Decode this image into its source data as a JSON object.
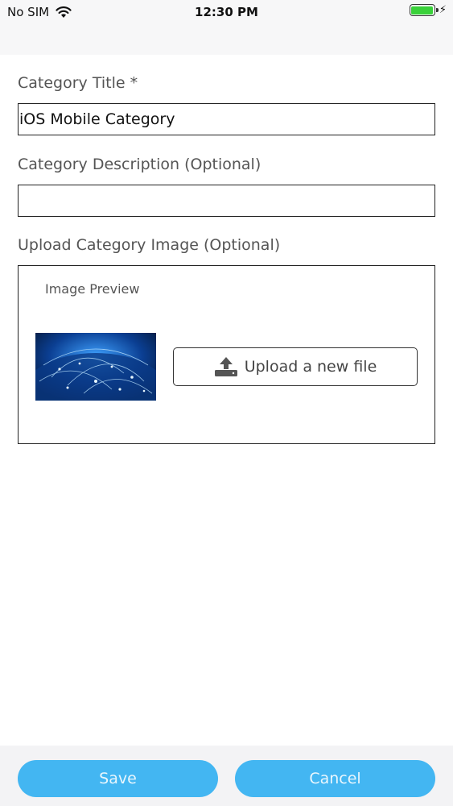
{
  "status_bar": {
    "carrier": "No SIM",
    "time": "12:30 PM",
    "battery_level": 1.0
  },
  "form": {
    "title_label": "Category Title *",
    "title_value": "iOS Mobile Category",
    "description_label": "Category Description (Optional)",
    "description_value": "",
    "image_label": "Upload Category Image (Optional)",
    "preview_label": "Image Preview",
    "upload_label": "Upload a new file"
  },
  "footer": {
    "save_label": "Save",
    "cancel_label": "Cancel"
  },
  "colors": {
    "accent": "#43b6f2",
    "battery": "#3ad13a"
  }
}
